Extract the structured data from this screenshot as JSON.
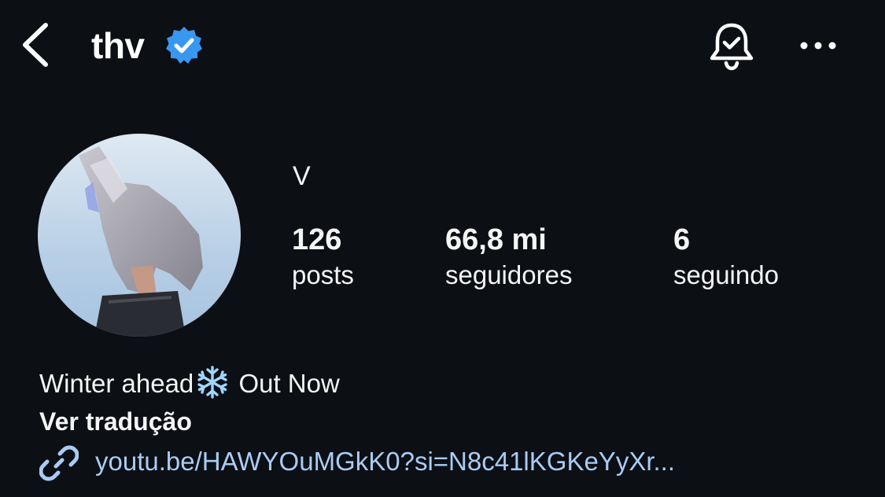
{
  "header": {
    "username": "thv",
    "back_icon": "chevron-left-icon",
    "verified_icon": "verified-badge-icon",
    "notification_icon": "bell-check-icon",
    "more_icon": "more-horizontal-icon"
  },
  "profile": {
    "display_name": "V",
    "stats": [
      {
        "value": "126",
        "label": "posts"
      },
      {
        "value": "66,8 mi",
        "label": "seguidores"
      },
      {
        "value": "6",
        "label": "seguindo"
      }
    ]
  },
  "bio": {
    "text_before": "Winter ahead",
    "emoji_icon": "snowflake-icon",
    "text_after": "Out Now",
    "translate_label": "Ver tradução",
    "link_icon": "link-icon",
    "link_text": "youtu.be/HAWYOuMGkK0?si=N8c41lKGKeYyXr..."
  },
  "colors": {
    "background": "#0c0f14",
    "text": "#f5f5f5",
    "verified_blue": "#3897f0",
    "link": "#a9ccf4"
  }
}
